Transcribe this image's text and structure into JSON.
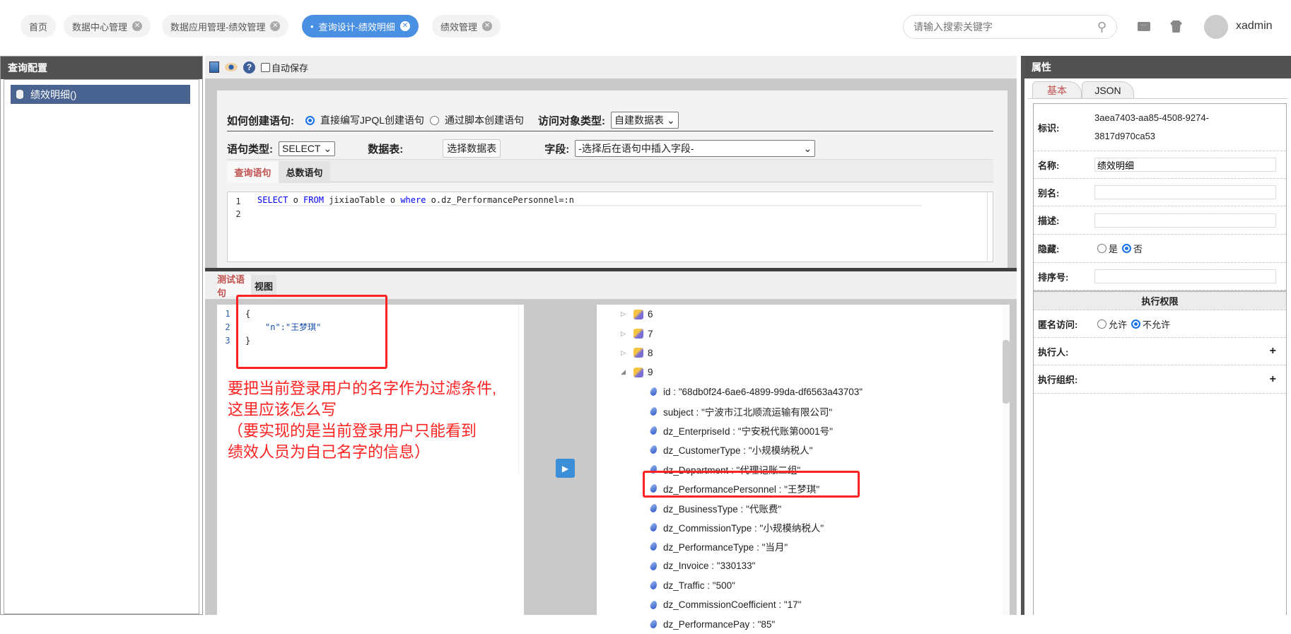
{
  "tabs": [
    {
      "label": "首页",
      "closable": false
    },
    {
      "label": "数据中心管理",
      "closable": true
    },
    {
      "label": "数据应用管理-绩效管理",
      "closable": true
    },
    {
      "label": "查询设计-绩效明细",
      "closable": true,
      "active": true
    },
    {
      "label": "绩效管理",
      "closable": true
    }
  ],
  "header": {
    "search_placeholder": "请输入搜索关键字",
    "username": "xadmin"
  },
  "left": {
    "title": "查询配置",
    "item": "绩效明细()"
  },
  "toolbar": {
    "autosave": "自动保存"
  },
  "form": {
    "create_label": "如何创建语句:",
    "opt_jpql": "直接编写JPQL创建语句",
    "opt_script": "通过脚本创建语句",
    "obj_type_label": "访问对象类型:",
    "obj_type_value": "自建数据表",
    "stmt_type_label": "语句类型:",
    "stmt_type_value": "SELECT",
    "table_label": "数据表:",
    "table_button": "选择数据表",
    "field_label": "字段:",
    "field_value": "-选择后在语句中插入字段-"
  },
  "query_tabs": [
    "查询语句",
    "总数语句"
  ],
  "query_code": {
    "kw1": "SELECT",
    "t1": " o ",
    "kw2": "FROM",
    "t2": " jixiaoTable o ",
    "kw3": "where",
    "t3": " o.dz_PerformancePersonnel=:n"
  },
  "test_tabs": [
    "测试语句",
    "视图"
  ],
  "test_code": [
    "{",
    "\"n\":\"王梦琪\"",
    "}"
  ],
  "annotation": [
    "要把当前登录用户的名字作为过滤条件,",
    "这里应该怎么写",
    "（要实现的是当前登录用户只能看到",
    "绩效人员为自己名字的信息）"
  ],
  "tree": {
    "nodes": [
      "6",
      "7",
      "8",
      "9"
    ],
    "fields": [
      "id : \"68db0f24-6ae6-4899-99da-df6563a43703\"",
      "subject : \"宁波市江北顺流运输有限公司\"",
      "dz_EnterpriseId : \"宁安税代账第0001号\"",
      "dz_CustomerType : \"小规模纳税人\"",
      "dz_Department : \"代理记账二组\"",
      "dz_PerformancePersonnel : \"王梦琪\"",
      "dz_BusinessType : \"代账费\"",
      "dz_CommissionType : \"小规模纳税人\"",
      "dz_PerformanceType : \"当月\"",
      "dz_Invoice : \"330133\"",
      "dz_Traffic : \"500\"",
      "dz_CommissionCoefficient : \"17\"",
      "dz_PerformancePay : \"85\""
    ]
  },
  "props": {
    "title": "属性",
    "tab_basic": "基本",
    "tab_json": "JSON",
    "id_label": "标识:",
    "id_value1": "3aea7403-aa85-4508-9274-",
    "id_value2": "3817d970ca53",
    "name_label": "名称:",
    "name_value": "绩效明细",
    "alias_label": "别名:",
    "desc_label": "描述:",
    "hidden_label": "隐藏:",
    "yes": "是",
    "no": "否",
    "order_label": "排序号:",
    "perm_title": "执行权限",
    "anon_label": "匿名访问:",
    "allow": "允许",
    "deny": "不允许",
    "executor_label": "执行人:",
    "exec_org_label": "执行组织:",
    "plus": "+"
  }
}
